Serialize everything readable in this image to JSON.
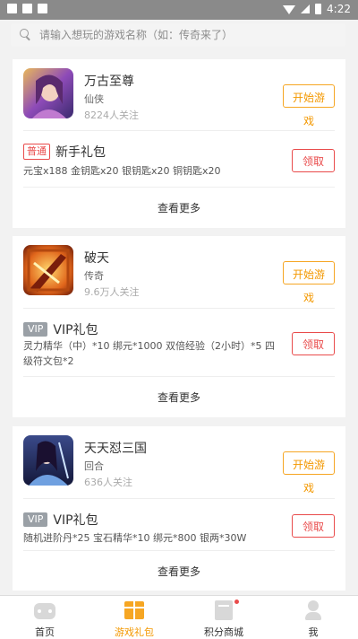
{
  "status_bar": {
    "time": "4:22"
  },
  "search": {
    "placeholder": "请输入想玩的游戏名称（如：传奇来了）"
  },
  "cards": [
    {
      "game": {
        "name": "万古至尊",
        "type": "仙侠",
        "followers": "8224人关注",
        "play_label": "开始游戏",
        "icon": "game-avatar-icon"
      },
      "gift": {
        "badge": "普通",
        "title": "新手礼包",
        "desc": "元宝x188 金钥匙x20 银钥匙x20 铜钥匙x20",
        "claim_label": "领取"
      },
      "more_label": "查看更多"
    },
    {
      "game": {
        "name": "破天",
        "type": "传奇",
        "followers": "9.6万人关注",
        "play_label": "开始游戏",
        "icon": "game-avatar-icon"
      },
      "gift": {
        "badge": "VIP",
        "title": "VIP礼包",
        "desc": "灵力精华（中）*10 绑元*1000 双倍经验（2小时）*5 四级符文包*2",
        "claim_label": "领取"
      },
      "more_label": "查看更多"
    },
    {
      "game": {
        "name": "天天怼三国",
        "type": "回合",
        "followers": "636人关注",
        "play_label": "开始游戏",
        "icon": "game-avatar-icon"
      },
      "gift": {
        "badge": "VIP",
        "title": "VIP礼包",
        "desc": "随机进阶丹*25 宝石精华*10 绑元*800 银两*30W",
        "claim_label": "领取"
      },
      "more_label": "查看更多"
    }
  ],
  "tabs": [
    {
      "label": "首页",
      "icon": "gamepad-icon"
    },
    {
      "label": "游戏礼包",
      "icon": "gift-icon",
      "active": true
    },
    {
      "label": "积分商城",
      "icon": "mall-icon"
    },
    {
      "label": "我",
      "icon": "user-icon"
    }
  ],
  "colors": {
    "accent": "#f39800",
    "danger": "#e94b4b",
    "status_bar": "#8a8a8a"
  }
}
